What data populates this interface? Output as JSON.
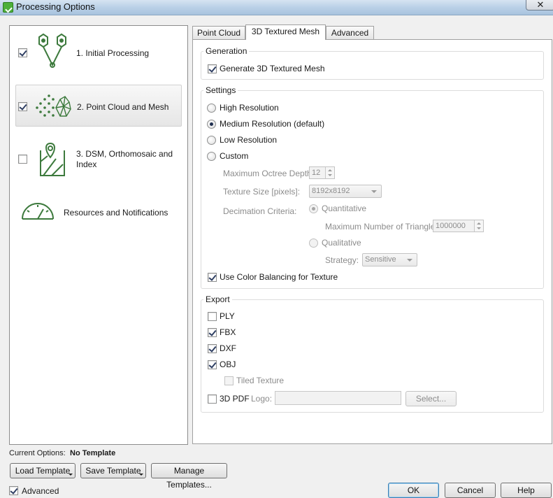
{
  "window": {
    "title": "Processing Options",
    "close_glyph": "✕"
  },
  "steps": [
    {
      "label": "1. Initial Processing",
      "checked": true,
      "icon": "initial-processing-icon"
    },
    {
      "label": "2. Point Cloud and Mesh",
      "checked": true,
      "icon": "point-cloud-mesh-icon"
    },
    {
      "label_line1": "3. DSM, Orthomosaic and",
      "label_line2": "Index",
      "checked": false,
      "icon": "dsm-map-icon"
    },
    {
      "label": "Resources and Notifications",
      "icon": "gauge-icon"
    }
  ],
  "tabs": [
    {
      "label": "Point Cloud",
      "active": false
    },
    {
      "label": "3D Textured Mesh",
      "active": true
    },
    {
      "label": "Advanced",
      "active": false
    }
  ],
  "generation": {
    "title": "Generation",
    "generate_label": "Generate 3D Textured Mesh",
    "generate_checked": true
  },
  "settings": {
    "title": "Settings",
    "resolutions": [
      {
        "label": "High Resolution",
        "selected": false
      },
      {
        "label": "Medium Resolution (default)",
        "selected": true
      },
      {
        "label": "Low Resolution",
        "selected": false
      },
      {
        "label": "Custom",
        "selected": false
      }
    ],
    "octree_label": "Maximum Octree Depth:",
    "octree_value": "12",
    "texture_label": "Texture Size [pixels]:",
    "texture_value": "8192x8192",
    "decimation_label": "Decimation Criteria:",
    "quantitative_label": "Quantitative",
    "max_triangles_label": "Maximum Number of Triangles:",
    "max_triangles_value": "1000000",
    "qualitative_label": "Qualitative",
    "strategy_label": "Strategy:",
    "strategy_value": "Sensitive",
    "color_balancing_label": "Use Color Balancing for Texture",
    "color_balancing_checked": true
  },
  "export": {
    "title": "Export",
    "ply_label": "PLY",
    "ply_checked": false,
    "fbx_label": "FBX",
    "fbx_checked": true,
    "dxf_label": "DXF",
    "dxf_checked": true,
    "obj_label": "OBJ",
    "obj_checked": true,
    "tiled_label": "Tiled Texture",
    "pdf_label": "3D PDF",
    "pdf_checked": false,
    "logo_label": "Logo:",
    "logo_value": "",
    "select_label": "Select..."
  },
  "footer": {
    "current_options_label": "Current Options:",
    "current_options_value": "No Template",
    "load_template": "Load Template",
    "save_template": "Save Template",
    "manage_templates": "Manage Templates...",
    "advanced_label": "Advanced",
    "advanced_checked": true,
    "ok": "OK",
    "cancel": "Cancel",
    "help": "Help"
  },
  "colors": {
    "icon_green": "#3d7a3d",
    "titlebar": "#bcd2e8"
  }
}
